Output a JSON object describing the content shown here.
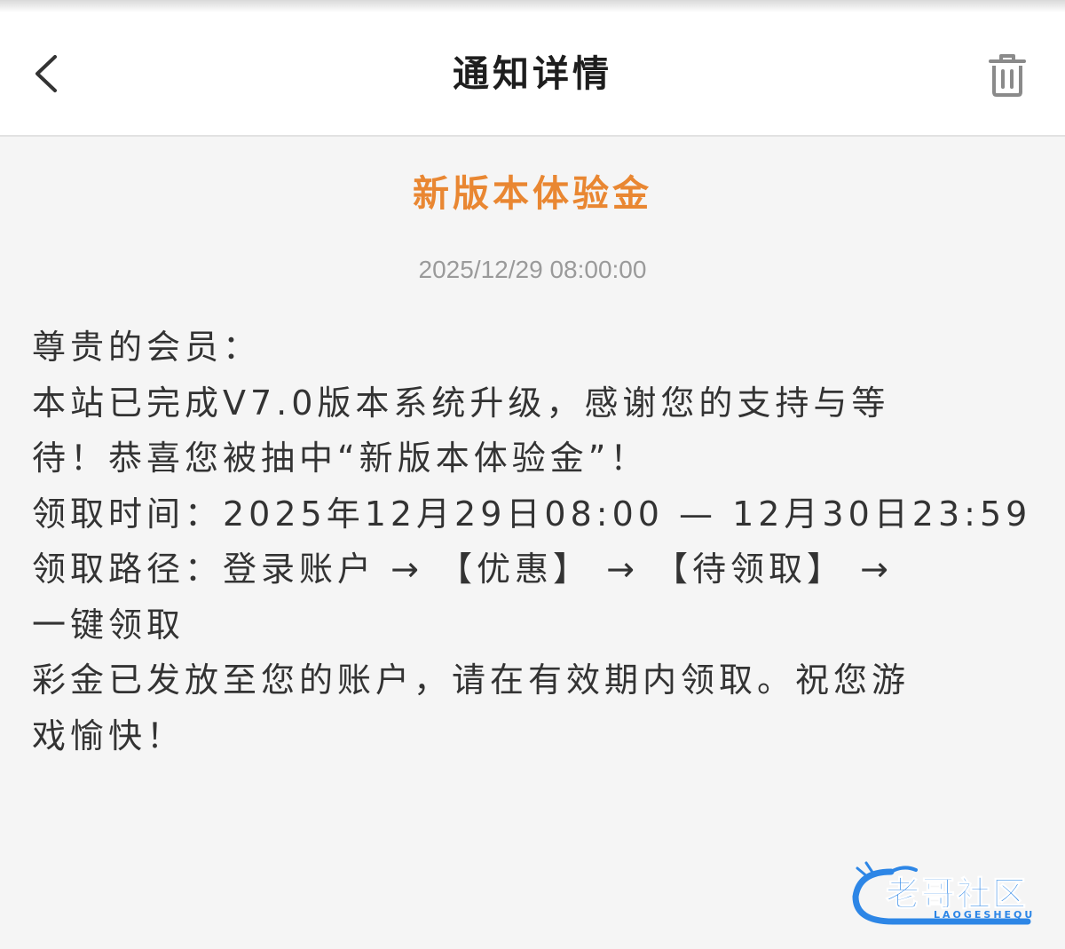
{
  "header": {
    "title": "通知详情",
    "back_icon": "chevron-left-icon",
    "delete_icon": "trash-icon"
  },
  "notice": {
    "title": "新版本体验金",
    "time": "2025/12/29  08:00:00",
    "body_lines": [
      "尊贵的会员：",
      "本站已完成V7.0版本系统升级，感谢您的支持与等",
      "待！恭喜您被抽中“新版本体验金”！",
      "领取时间：2025年12月29日08:00 — 12月30日23:59",
      "领取路径：登录账户 → 【优惠】 → 【待领取】 →",
      "一键领取",
      "彩金已发放至您的账户，请在有效期内领取。祝您游",
      "戏愉快！"
    ]
  },
  "watermark": {
    "text": "老哥社区",
    "sub": "LAOGESHEQU"
  },
  "colors": {
    "accent": "#e98732",
    "text": "#333333",
    "muted": "#9a9a9a",
    "watermark": "#2d86e6"
  }
}
